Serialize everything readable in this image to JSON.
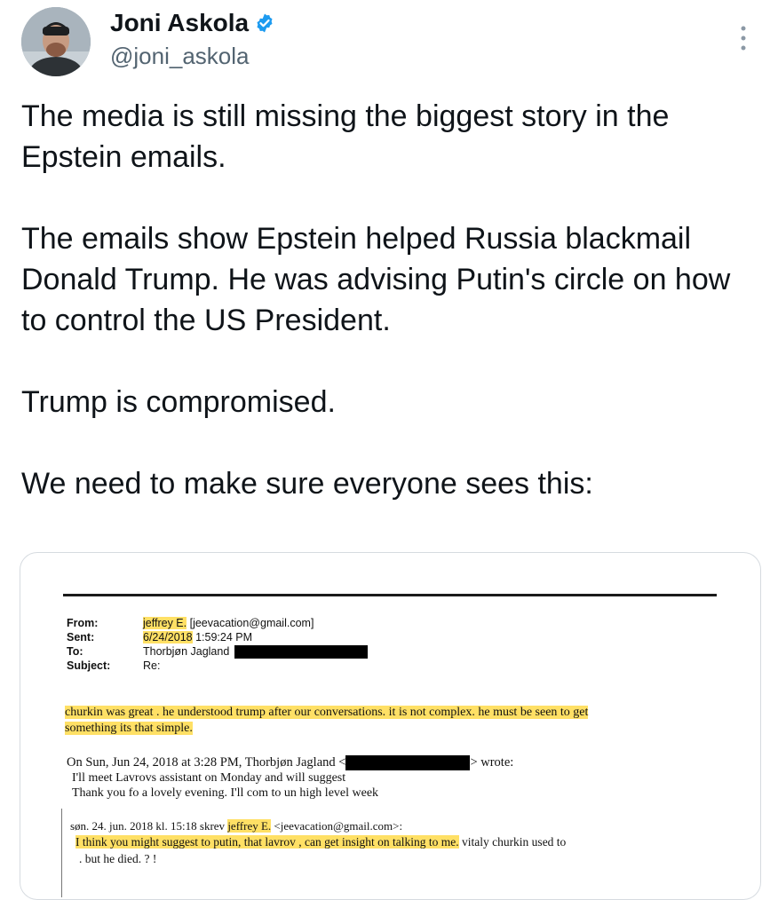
{
  "author": {
    "display_name": "Joni Askola",
    "handle": "@joni_askola",
    "verified": true,
    "verified_color": "#1d9bf0"
  },
  "tweet": {
    "paragraphs": [
      "The media is still missing the biggest story in the Epstein emails.",
      "The emails show Epstein helped Russia blackmail Donald Trump. He was advising Putin's circle on how to control the US President.",
      "Trump is compromised.",
      "We need to make sure everyone sees this:"
    ]
  },
  "email": {
    "from_label": "From:",
    "from_name": "jeffrey E.",
    "from_addr": "[jeevacation@gmail.com]",
    "sent_label": "Sent:",
    "sent_date": "6/24/2018",
    "sent_time": "1:59:24 PM",
    "to_label": "To:",
    "to_value": "Thorbjøn Jagland",
    "subject_label": "Subject:",
    "subject_value": "Re:",
    "body_line1": "churkin was great .  he understood trump after our conversations.   it is not complex.   he must be seen to get",
    "body_line2": "something   its that simple.",
    "quote_header_a": "On Sun, Jun 24, 2018 at 3:28 PM, Thorbjøn Jagland <",
    "quote_header_b": "> wrote:",
    "quote_line1": "I'll meet Lavrovs assistant on Monday and will suggest",
    "quote_line2": "Thank you fo a lovely evening. I'll com to un high level week",
    "nested_header_a": "søn. 24. jun. 2018 kl. 15:18 skrev ",
    "nested_header_name": "jeffrey E.",
    "nested_header_addr": " <jeevacation@gmail.com>:",
    "nested_line1_hl": "I think you might suggest to putin,  that lavrov , can get insight on talking to me.",
    "nested_line1_rest": "  vitaly churkin  used to",
    "nested_line2": ".   but he died. ? !"
  },
  "colors": {
    "highlight": "#ffd532",
    "text": "#0f1419",
    "muted": "#536471"
  }
}
